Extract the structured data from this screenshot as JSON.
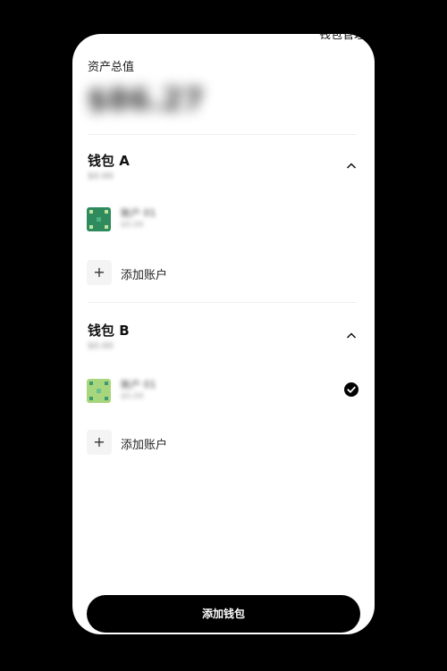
{
  "header": {
    "back_icon": "chevron-left-icon",
    "title": "钱包管理"
  },
  "total": {
    "label": "资产总值",
    "value": "$86.27"
  },
  "wallets": [
    {
      "title": "钱包 A",
      "subtitle": "$0.00",
      "accounts": [
        {
          "name": "账户 01",
          "balance": "$0.00",
          "selected": false
        }
      ],
      "add_account_label": "添加账户"
    },
    {
      "title": "钱包 B",
      "subtitle": "$0.00",
      "accounts": [
        {
          "name": "账户 01",
          "balance": "$0.00",
          "selected": true
        }
      ],
      "add_account_label": "添加账户"
    }
  ],
  "footer": {
    "add_wallet_label": "添加钱包"
  },
  "colors": {
    "background": "#000000",
    "card": "#ffffff",
    "primary_button": "#000000",
    "avatar_a": "#2f8a5e",
    "avatar_b": "#a7d67c"
  }
}
